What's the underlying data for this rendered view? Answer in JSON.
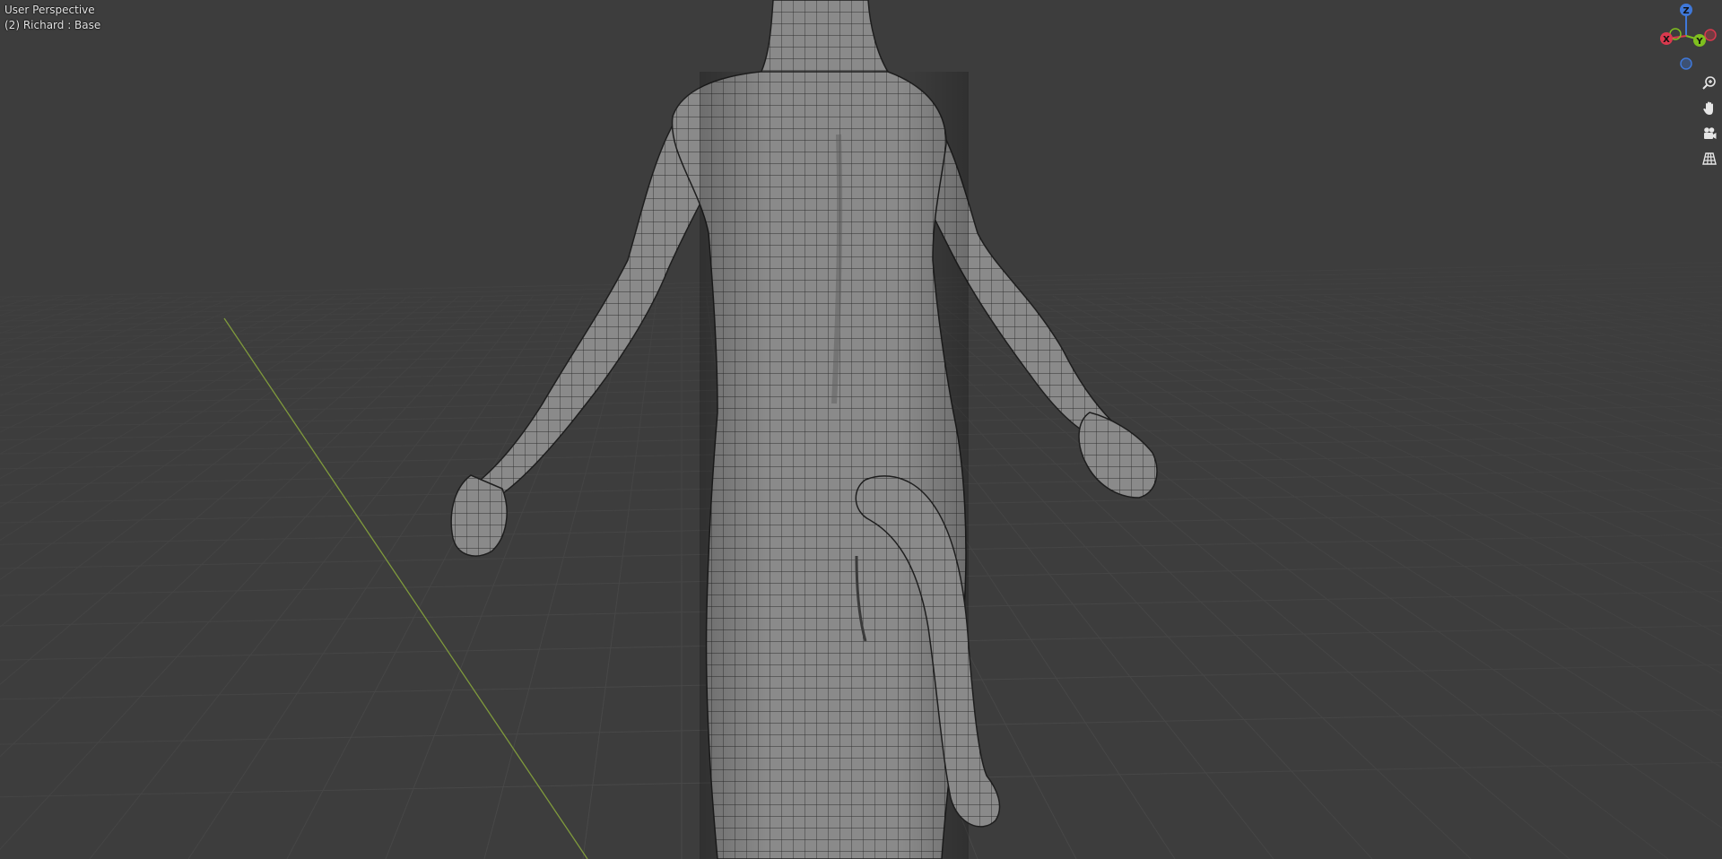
{
  "viewport": {
    "view_name": "User Perspective",
    "object_info": "(2) Richard : Base",
    "background_color": "#3d3d3d",
    "grid_line_color": "#4a4a4a",
    "y_axis_color": "#7f9a3c",
    "mesh_color": "#8e8e8e",
    "wire_color": "#2a2a2a"
  },
  "gizmo": {
    "x_label": "X",
    "y_label": "Y",
    "z_label": "Z",
    "x_color": "#d9394e",
    "y_color": "#7fbf1f",
    "z_color": "#3f78d9"
  },
  "navigation_tools": [
    {
      "name": "zoom",
      "icon": "magnifier-plus-icon"
    },
    {
      "name": "pan",
      "icon": "hand-icon"
    },
    {
      "name": "camera",
      "icon": "camera-icon"
    },
    {
      "name": "orthographic",
      "icon": "grid-perspective-icon"
    }
  ]
}
